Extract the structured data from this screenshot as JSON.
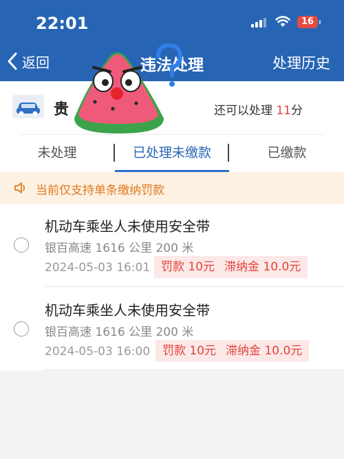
{
  "status_bar": {
    "time": "22:01",
    "battery": "16"
  },
  "nav": {
    "back_label": "返回",
    "title": "违法处理",
    "history_label": "处理历史"
  },
  "vehicle": {
    "plate": "贵",
    "remaining_prefix": "还可以处理",
    "remaining_count": "11",
    "remaining_suffix": "分"
  },
  "tabs": [
    {
      "label": "未处理",
      "active": false
    },
    {
      "label": "已处理未缴款",
      "active": true
    },
    {
      "label": "已缴款",
      "active": false
    }
  ],
  "notice": {
    "text": "当前仅支持单条缴纳罚款"
  },
  "violations": [
    {
      "title": "机动车乘坐人未使用安全带",
      "location": "银百高速 1616 公里 200 米",
      "datetime": "2024-05-03 16:01",
      "fine": "罚款 10元",
      "late_fee": "滞纳金 10.0元"
    },
    {
      "title": "机动车乘坐人未使用安全带",
      "location": "银百高速 1616 公里 200 米",
      "datetime": "2024-05-03 16:00",
      "fine": "罚款 10元",
      "late_fee": "滞纳金 10.0元"
    }
  ],
  "colors": {
    "primary": "#2765b4",
    "danger": "#e0453a",
    "warning": "#e07a1e",
    "notice_bg": "#fdf1e4",
    "fine_bg": "#fde8e8"
  }
}
